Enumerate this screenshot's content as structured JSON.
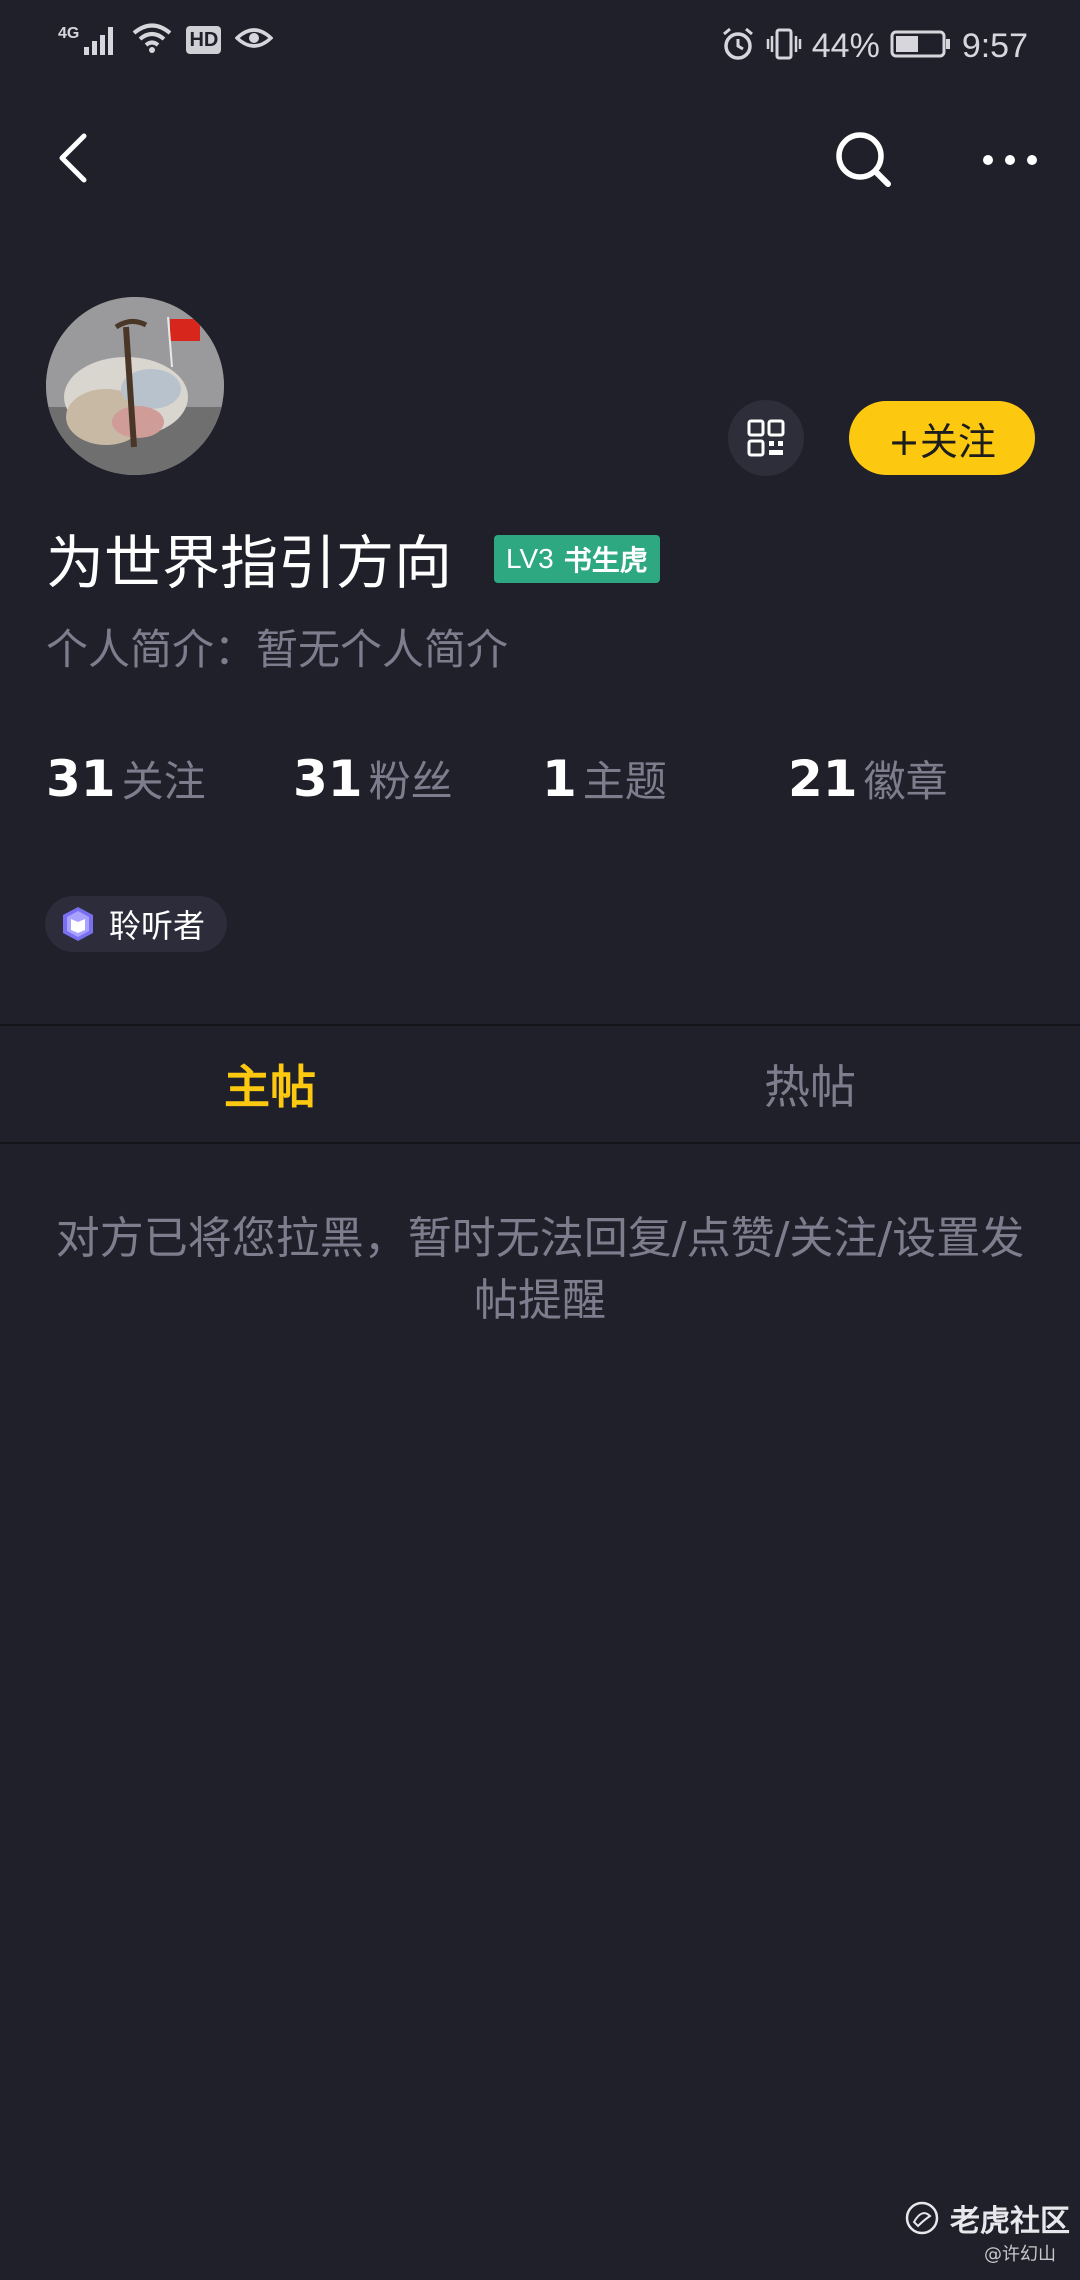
{
  "status_bar": {
    "network": "4G",
    "hd": "HD",
    "battery_percent": "44%",
    "time": "9:57",
    "icons": [
      "signal-icon",
      "wifi-icon",
      "hd-icon",
      "eye-icon",
      "alarm-icon",
      "vibrate-icon",
      "battery-icon"
    ]
  },
  "top_bar": {
    "icons": [
      "back-icon",
      "search-icon",
      "more-icon"
    ]
  },
  "profile": {
    "username": "为世界指引方向",
    "level": "LV3",
    "level_title": "书生虎",
    "bio": "个人简介：暂无个人简介",
    "follow_label": "+关注",
    "accent_color": "#fcc810",
    "badge_color": "#2ea881"
  },
  "stats": [
    {
      "num": "31",
      "label": "关注"
    },
    {
      "num": "31",
      "label": "粉丝"
    },
    {
      "num": "1",
      "label": "主题"
    },
    {
      "num": "21",
      "label": "徽章"
    }
  ],
  "tag": {
    "label": "聆听者"
  },
  "tabs": [
    {
      "label": "主帖",
      "active": true
    },
    {
      "label": "热帖",
      "active": false
    }
  ],
  "notice": "对方已将您拉黑，暂时无法回复/点赞/关注/设置发帖提醒",
  "watermark": {
    "name": "老虎社区",
    "handle": "@许幻山"
  }
}
